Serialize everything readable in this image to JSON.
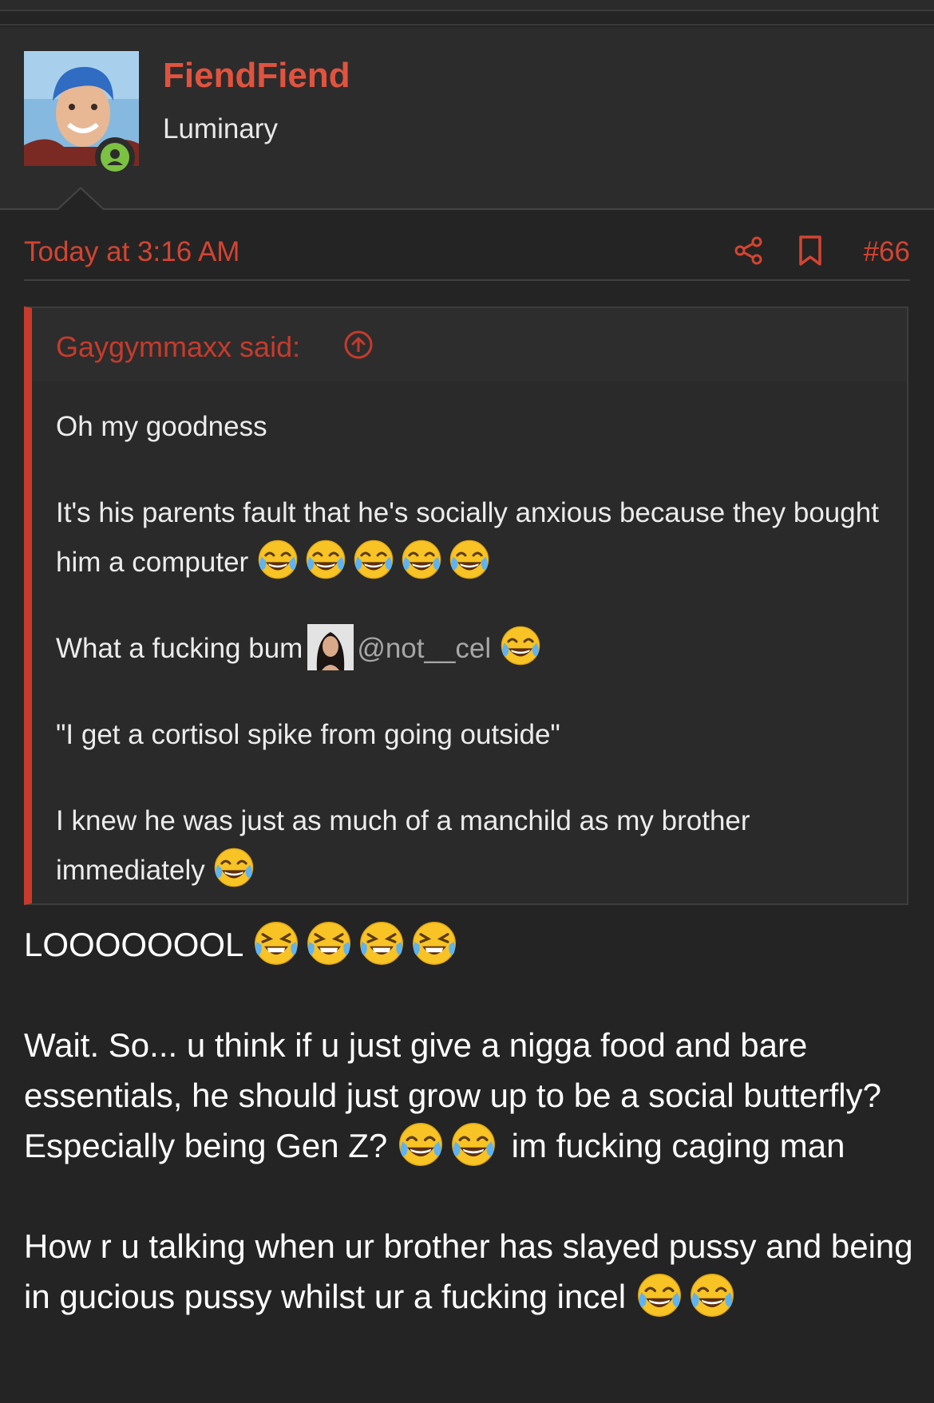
{
  "user": {
    "name": "FiendFiend",
    "title": "Luminary"
  },
  "post": {
    "date": "Today at 3:16 AM",
    "number": "#66"
  },
  "quote": {
    "author": "Gaygymmaxx said:",
    "line1": "Oh my goodness",
    "line2": "It's his parents fault that he's socially anxious because they bought him a computer",
    "line3": "What a fucking bum",
    "mention": "@not__cel",
    "line4": "\"I get a cortisol spike from going outside\"",
    "line5": "I knew he was just as much of a manchild as my brother immediately"
  },
  "reply": {
    "line1": "LOOOOOOOL",
    "para2a": "Wait. So... u think if u just give a nigga food and bare essentials, he should just grow up to be a social butterfly? Especially being Gen Z?",
    "para2b": "im fucking caging man",
    "para3": "How r u talking when ur brother has slayed pussy and being in gucious pussy whilst ur a fucking incel"
  },
  "icons": {
    "share": "share-icon",
    "bookmark": "bookmark-icon",
    "quote_link": "arrow-up-circle-icon",
    "status": "online-status-icon",
    "emoji_joy": "face-with-tears-of-joy-emoji",
    "emoji_rofl": "squinting-laughing-emoji"
  },
  "colors": {
    "background": "#242424",
    "accent": "#d44431",
    "username": "#e0533f",
    "online": "#7cc142"
  }
}
